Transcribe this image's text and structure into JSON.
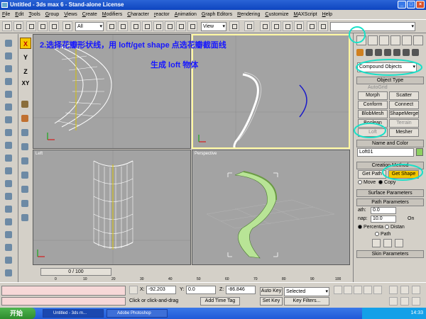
{
  "window": {
    "title": "Untitled - 3ds max 6 - Stand-alone License"
  },
  "menu": [
    "File",
    "Edit",
    "Tools",
    "Group",
    "Views",
    "Create",
    "Modifiers",
    "Character",
    "reactor",
    "Animation",
    "Graph Editors",
    "Rendering",
    "Customize",
    "MAXScript",
    "Help"
  ],
  "toolbar": {
    "selection_filter": "All",
    "ref_coord": "View"
  },
  "annotations": {
    "line1": "2.选择花瓣形状线，用 loft/get shape 点选花瓣截面线",
    "line2": "生成 loft 物体"
  },
  "axis_buttons": [
    "X",
    "Y",
    "Z",
    "XY"
  ],
  "viewports": {
    "top_left": "",
    "top_right": "",
    "bottom_left": "Left",
    "bottom_right": "Perspective"
  },
  "command_panel": {
    "category_dropdown": "Compound Objects",
    "object_type_header": "Object Type",
    "autogrid_label": "AutoGrid",
    "object_buttons": [
      "Morph",
      "Scatter",
      "Conform",
      "Connect",
      "BlobMesh",
      "ShapeMerge",
      "Boolean",
      "Terrain",
      "Loft",
      "Mesher"
    ],
    "name_color_header": "Name and Color",
    "object_name": "Loft01",
    "creation_method_header": "Creation Method",
    "get_path": "Get Path",
    "get_shape": "Get Shape",
    "move_label": "Move",
    "copy_label": "Copy",
    "surface_params_header": "Surface Parameters",
    "path_params_header": "Path Parameters",
    "path_label": "ath:",
    "path_value": "0.0",
    "snap_label": "nap:",
    "snap_value": "10.0",
    "on_label": "On",
    "percent_label": "Percenta",
    "distance_label": "Distan",
    "path_steps_label": "Path",
    "skin_params_header": "Skin Parameters"
  },
  "timeline": {
    "slider": "0 / 100",
    "ticks": [
      "0",
      "10",
      "20",
      "30",
      "40",
      "50",
      "60",
      "70",
      "80",
      "90",
      "100"
    ]
  },
  "status": {
    "x_label": "X:",
    "x_value": "-92.203",
    "y_label": "Y:",
    "y_value": "0.0",
    "z_label": "Z:",
    "z_value": "-86.846",
    "prompt": "Click or click-and-drag",
    "add_time_tag": "Add Time Tag",
    "auto_key": "Auto Key",
    "selected": "Selected",
    "set_key": "Set Key",
    "key_filters": "Key Filters..."
  },
  "taskbar": {
    "start": "开始",
    "tasks": [
      "Untitled - 3ds m...",
      "Adobe Photoshop"
    ],
    "clock": "14:33"
  },
  "colors": {
    "annotation": "#1818ff",
    "highlight_circle": "#19e0c8",
    "active_button": "#f4c800",
    "loft_green": "#8dd060"
  }
}
